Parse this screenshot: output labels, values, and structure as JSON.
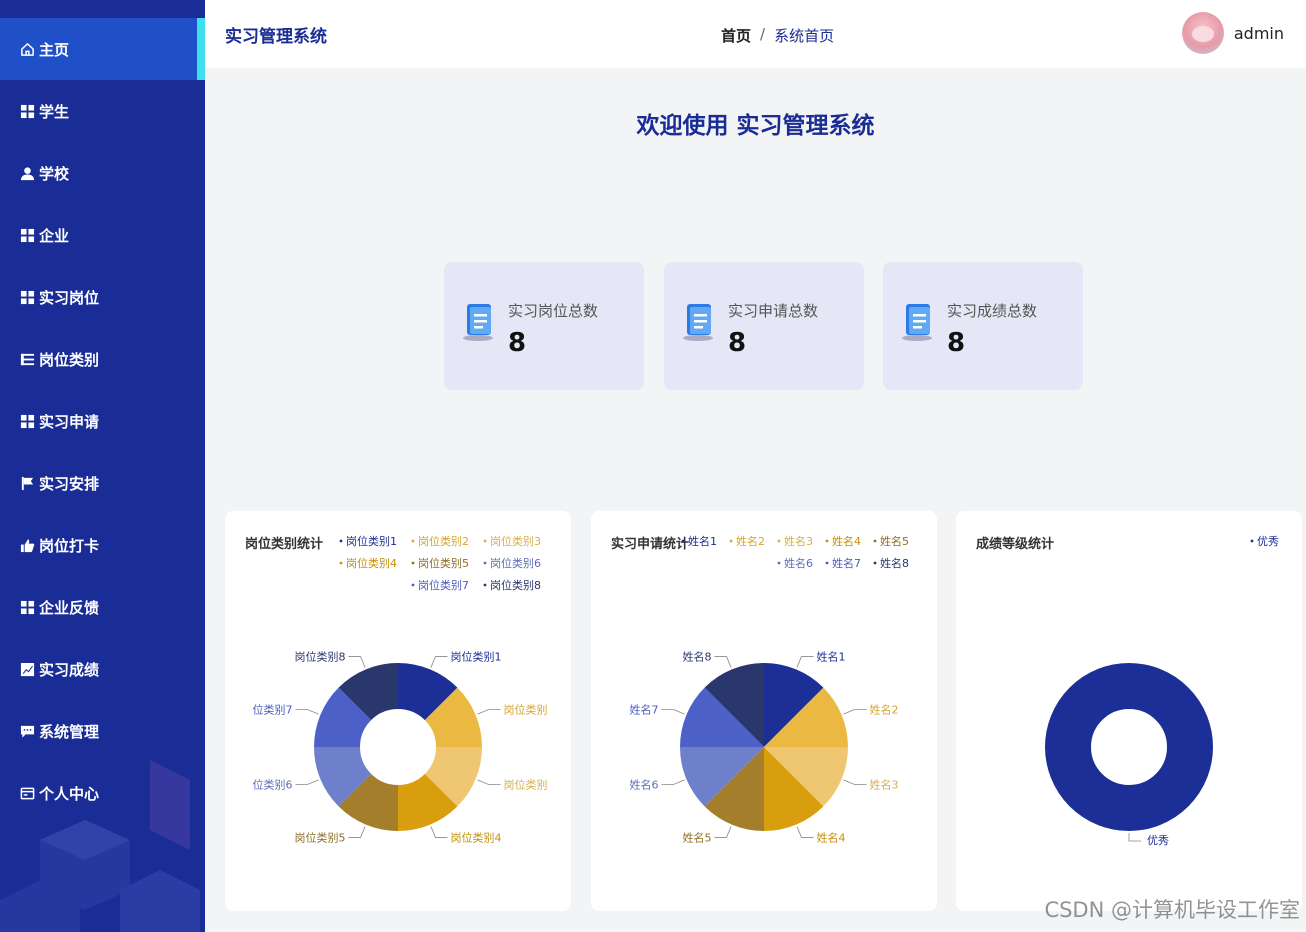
{
  "app": {
    "title": "实习管理系统"
  },
  "sidebar": {
    "items": [
      {
        "label": "主页",
        "icon": "home-icon",
        "active": true
      },
      {
        "label": "学生",
        "icon": "grid-icon"
      },
      {
        "label": "学校",
        "icon": "user-icon"
      },
      {
        "label": "企业",
        "icon": "grid-icon"
      },
      {
        "label": "实习岗位",
        "icon": "grid-icon"
      },
      {
        "label": "岗位类别",
        "icon": "list-icon"
      },
      {
        "label": "实习申请",
        "icon": "grid-icon"
      },
      {
        "label": "实习安排",
        "icon": "flag-icon"
      },
      {
        "label": "岗位打卡",
        "icon": "thumb-icon"
      },
      {
        "label": "企业反馈",
        "icon": "grid-icon"
      },
      {
        "label": "实习成绩",
        "icon": "chart-icon"
      },
      {
        "label": "系统管理",
        "icon": "chat-icon"
      },
      {
        "label": "个人中心",
        "icon": "card-icon"
      }
    ]
  },
  "header": {
    "breadcrumb": {
      "home": "首页",
      "separator": "/",
      "current": "系统首页"
    },
    "user": {
      "name": "admin"
    }
  },
  "welcome": "欢迎使用 实习管理系统",
  "stats": [
    {
      "label": "实习岗位总数",
      "value": "8"
    },
    {
      "label": "实习申请总数",
      "value": "8"
    },
    {
      "label": "实习成绩总数",
      "value": "8"
    }
  ],
  "colors": {
    "primary": "#1a2c95",
    "active": "#2050c8",
    "accent": "#3fe0ee",
    "palette": [
      "#1b2f96",
      "#ebb942",
      "#efc772",
      "#d89e0e",
      "#a57e2c",
      "#6e7fcb",
      "#4c60c7",
      "#2a376d"
    ]
  },
  "watermark": "CSDN @计算机毕设工作室",
  "chart_data": [
    {
      "type": "pie",
      "donut": true,
      "title": "岗位类别统计",
      "categories": [
        "岗位类别1",
        "岗位类别2",
        "岗位类别3",
        "岗位类别4",
        "岗位类别5",
        "岗位类别6",
        "岗位类别7",
        "岗位类别8"
      ],
      "values": [
        1,
        1,
        1,
        1,
        1,
        1,
        1,
        1
      ],
      "slice_labels": [
        "岗位类别1",
        "岗位类别",
        "岗位类别",
        "岗位类别4",
        "岗位类别5",
        "位类别6",
        "位类别7",
        "岗位类别8"
      ],
      "legend": "top-right"
    },
    {
      "type": "pie",
      "donut": false,
      "title": "实习申请统计",
      "categories": [
        "姓名1",
        "姓名2",
        "姓名3",
        "姓名4",
        "姓名5",
        "姓名6",
        "姓名7",
        "姓名8"
      ],
      "values": [
        1,
        1,
        1,
        1,
        1,
        1,
        1,
        1
      ],
      "legend": "top-right"
    },
    {
      "type": "pie",
      "donut": true,
      "title": "成绩等级统计",
      "categories": [
        "优秀"
      ],
      "values": [
        8
      ],
      "legend": "top-right"
    }
  ]
}
